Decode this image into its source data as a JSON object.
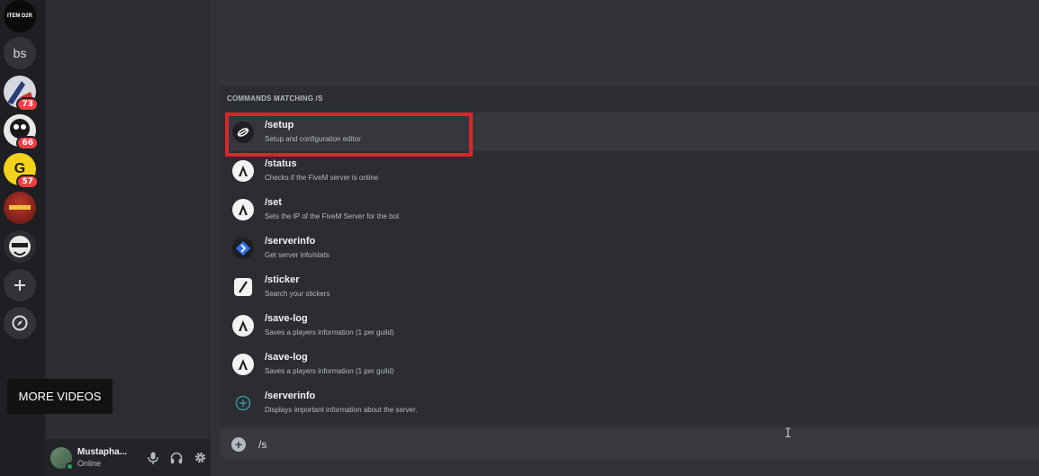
{
  "servers": [
    {
      "label": "ITEM D2R",
      "badge": ""
    },
    {
      "label": "bs",
      "badge": ""
    },
    {
      "label": "",
      "badge": "73"
    },
    {
      "label": "",
      "badge": "66"
    },
    {
      "label": "G",
      "badge": "57"
    },
    {
      "label": "",
      "badge": ""
    },
    {
      "label": "",
      "badge": ""
    }
  ],
  "rail": {
    "add_icon": "plus-icon",
    "explore_icon": "compass-icon"
  },
  "overlay": {
    "more_videos": "MORE VIDEOS"
  },
  "user": {
    "name": "Mustapha...",
    "status": "Online"
  },
  "popup": {
    "title": "COMMANDS MATCHING /S",
    "commands": [
      {
        "name": "/setup",
        "desc": "Setup and configuration editor",
        "icon": "setup-bot-icon"
      },
      {
        "name": "/status",
        "desc": "Checks if the FiveM server is online",
        "icon": "fivem-bot-icon"
      },
      {
        "name": "/set",
        "desc": "Sets the IP of the FiveM Server for the bot",
        "icon": "fivem-bot-icon"
      },
      {
        "name": "/serverinfo",
        "desc": "Get server info/stats",
        "icon": "serverinfo-bot-icon"
      },
      {
        "name": "/sticker",
        "desc": "Search your stickers",
        "icon": "sticker-icon"
      },
      {
        "name": "/save-log",
        "desc": "Saves a players information (1 per guild)",
        "icon": "fivem-bot-icon"
      },
      {
        "name": "/save-log",
        "desc": "Saves a players information (1 per guild)",
        "icon": "fivem-bot-icon"
      },
      {
        "name": "/serverinfo",
        "desc": "Displays important information about the server.",
        "icon": "add-circle-icon"
      }
    ]
  },
  "input": {
    "value": "/s"
  },
  "colors": {
    "highlight": "#d9262b",
    "badge": "#f23f43",
    "online": "#23a55a"
  }
}
